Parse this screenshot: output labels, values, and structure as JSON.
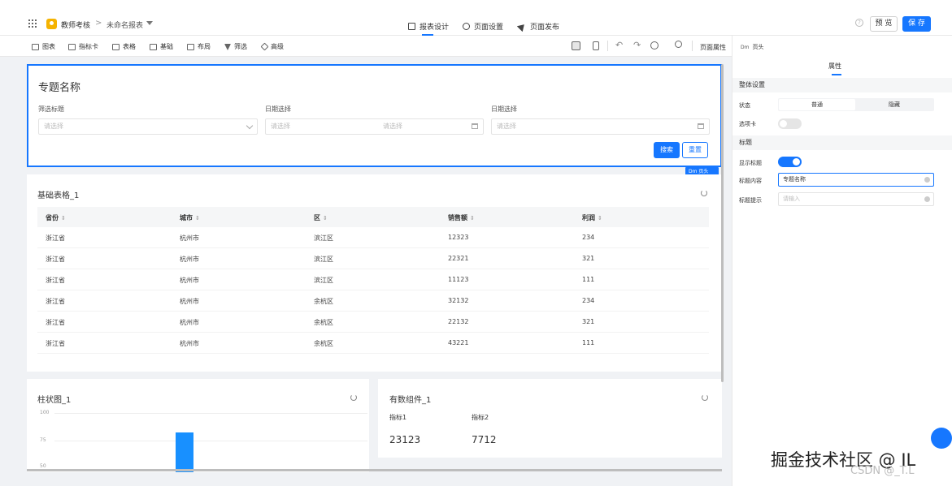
{
  "header": {
    "app_name": "教师考核",
    "crumb_separator": ">",
    "report_name": "未命名报表",
    "tabs": [
      {
        "label": "报表设计",
        "icon": "report-design-icon"
      },
      {
        "label": "页面设置",
        "icon": "gear-icon"
      },
      {
        "label": "页面发布",
        "icon": "send-icon"
      }
    ],
    "help_label": "?",
    "preview_label": "预 览",
    "save_label": "保 存",
    "accent_color": "#1677ff"
  },
  "toolbar": {
    "items": [
      {
        "label": "图表",
        "icon": "chart-icon"
      },
      {
        "label": "指标卡",
        "icon": "indicator-card-icon"
      },
      {
        "label": "表格",
        "icon": "table-icon"
      },
      {
        "label": "基础",
        "icon": "basic-icon"
      },
      {
        "label": "布局",
        "icon": "layout-icon"
      },
      {
        "label": "筛选",
        "icon": "filter-icon"
      },
      {
        "label": "高级",
        "icon": "advanced-icon"
      }
    ],
    "undo_glyph": "↶",
    "redo_glyph": "↷",
    "page_props_label": "页面属性"
  },
  "filter_card": {
    "title": "专题名称",
    "filters": [
      {
        "label": "筛选标题",
        "placeholder": "请选择"
      },
      {
        "label": "日期选择",
        "placeholder_start": "请选择",
        "placeholder_end": "请选择"
      },
      {
        "label": "日期选择",
        "placeholder": "请选择"
      }
    ],
    "search_label": "搜索",
    "reset_label": "重置",
    "dim_tag": "Dm 页头"
  },
  "table_card": {
    "title": "基础表格_1",
    "columns": [
      "省份",
      "城市",
      "区",
      "销售额",
      "利润"
    ],
    "rows": [
      [
        "浙江省",
        "杭州市",
        "滨江区",
        "12323",
        "234"
      ],
      [
        "浙江省",
        "杭州市",
        "滨江区",
        "22321",
        "321"
      ],
      [
        "浙江省",
        "杭州市",
        "滨江区",
        "11123",
        "111"
      ],
      [
        "浙江省",
        "杭州市",
        "余杭区",
        "32132",
        "234"
      ],
      [
        "浙江省",
        "杭州市",
        "余杭区",
        "22132",
        "321"
      ],
      [
        "浙江省",
        "杭州市",
        "余杭区",
        "43221",
        "111"
      ]
    ]
  },
  "bar_card": {
    "title": "柱状图_1",
    "y_ticks": [
      "100",
      "75",
      "50"
    ],
    "bar_value": 82,
    "bar_color": "#1890ff"
  },
  "kpi_card": {
    "title": "有数组件_1",
    "items": [
      {
        "label": "指标1",
        "value": "23123"
      },
      {
        "label": "指标2",
        "value": "7712"
      }
    ]
  },
  "panel": {
    "tag": "Dm",
    "head": "页头",
    "tab_label": "属性",
    "section_overall": "整体设置",
    "state_label": "状态",
    "state_options": [
      "普通",
      "隐藏"
    ],
    "state_selected": "普通",
    "tabcard_label": "选项卡",
    "tabcard_on": false,
    "section_title": "标题",
    "show_title_label": "显示标题",
    "show_title_on": true,
    "title_content_label": "标题内容",
    "title_content_value": "专题名称",
    "title_hint_label": "标题提示",
    "title_hint_placeholder": "请输入"
  },
  "watermark": {
    "main": "掘金技术社区 @ IL",
    "sub": "CSDN @_T.L"
  }
}
